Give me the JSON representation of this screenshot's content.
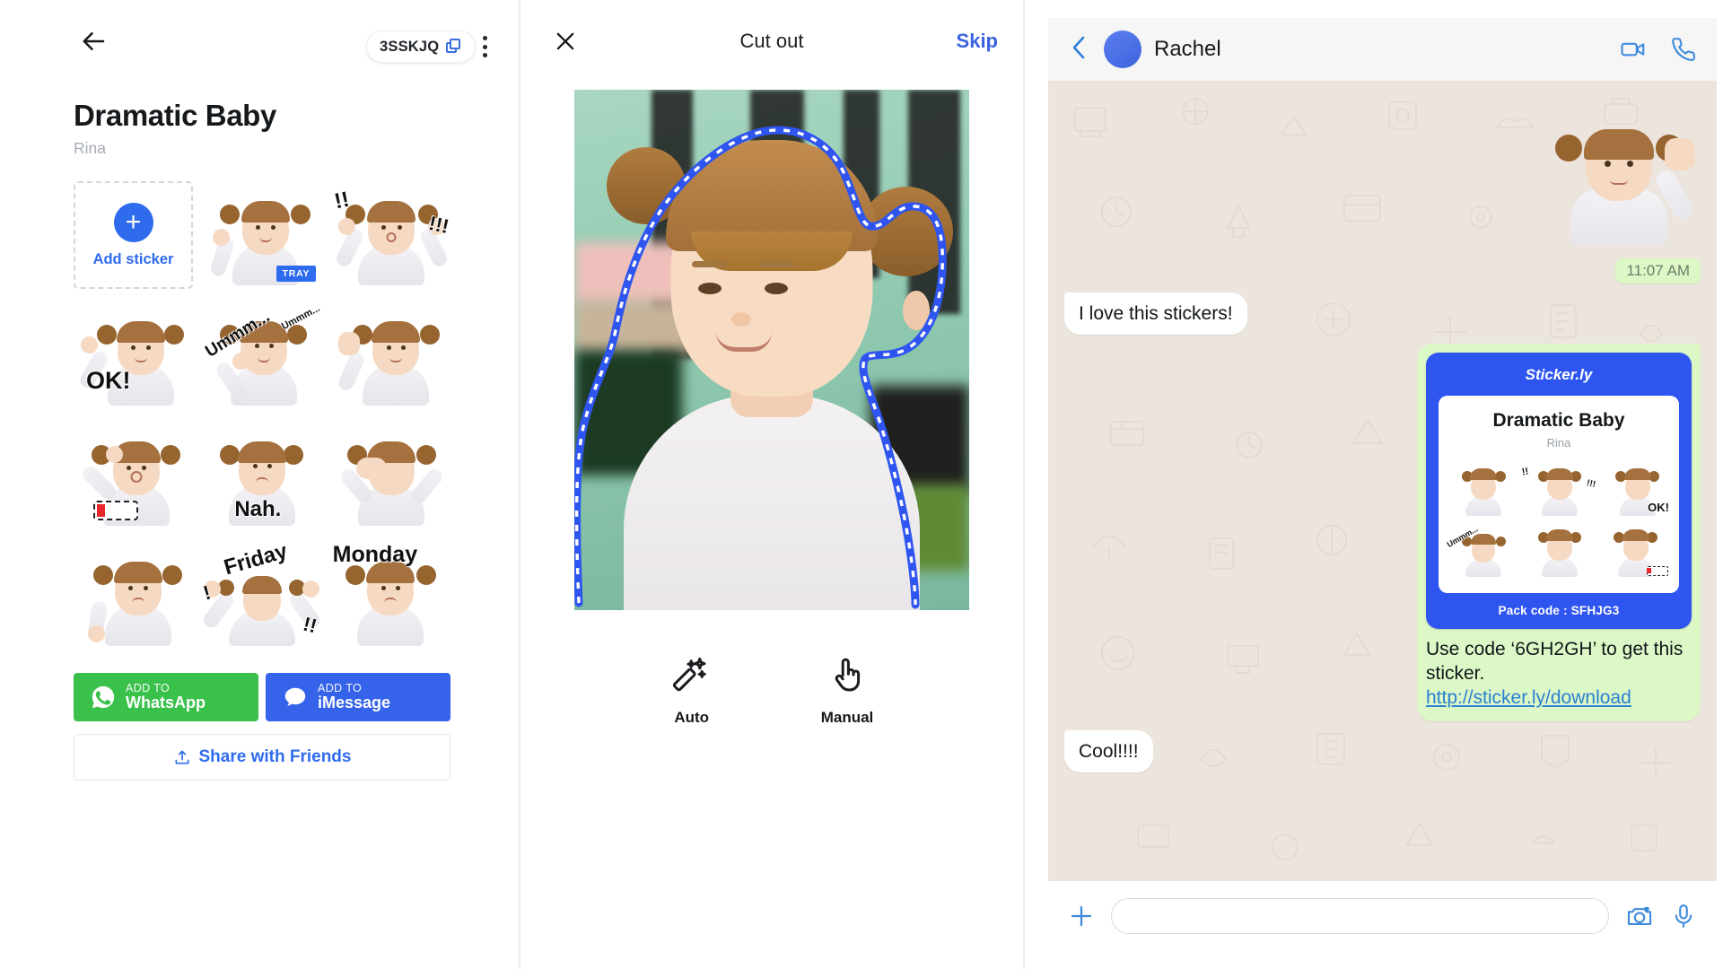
{
  "pack_detail": {
    "back_icon": "back-arrow-icon",
    "pack_code_pill": "3SSKJQ",
    "copy_icon": "copy-icon",
    "menu_icon": "kebab-menu-icon",
    "title": "Dramatic Baby",
    "author": "Rina",
    "add_sticker": {
      "plus_icon": "plus-icon",
      "label": "Add sticker"
    },
    "tray_badge": "TRAY",
    "stickers": [
      {
        "caption": "",
        "name": "sticker-thumbs-up",
        "tray": true
      },
      {
        "caption": "!!",
        "caption2": "!!!",
        "name": "sticker-shock"
      },
      {
        "caption": "OK!",
        "name": "sticker-ok"
      },
      {
        "caption": "Ummm...",
        "caption2": "Ummm...",
        "name": "sticker-ummm"
      },
      {
        "caption": "",
        "name": "sticker-stop-hand"
      },
      {
        "caption": "",
        "name": "sticker-low-battery"
      },
      {
        "caption": "Nah.",
        "name": "sticker-nah"
      },
      {
        "caption": "",
        "name": "sticker-facepalm"
      },
      {
        "caption": "",
        "name": "sticker-thumbs-down"
      },
      {
        "caption": "Friday",
        "caption2": "!",
        "caption3": "!!",
        "name": "sticker-friday"
      },
      {
        "caption": "Monday",
        "name": "sticker-monday"
      }
    ],
    "whatsapp_button": {
      "top": "ADD TO",
      "main": "WhatsApp",
      "icon": "whatsapp-icon",
      "color": "#3ac14b"
    },
    "imessage_button": {
      "top": "ADD TO",
      "main": "iMessage",
      "icon": "imessage-icon",
      "color": "#3563e9"
    },
    "share_button": {
      "label": "Share with Friends",
      "icon": "share-upload-icon",
      "color": "#2f6bed"
    }
  },
  "cut_out": {
    "close_icon": "close-x-icon",
    "title": "Cut out",
    "skip_label": "Skip",
    "selection_icon": "dashed-selection-path",
    "tools": [
      {
        "label": "Auto",
        "icon": "magic-wand-icon"
      },
      {
        "label": "Manual",
        "icon": "pointing-hand-icon"
      }
    ]
  },
  "chat": {
    "back_icon": "chevron-left-icon",
    "avatar": "contact-avatar",
    "contact_name": "Rachel",
    "video_icon": "video-camera-icon",
    "call_icon": "phone-call-icon",
    "timestamp": "11:07 AM",
    "incoming_message": "I love this stickers!",
    "reply_message": "Cool!!!!",
    "sticker_card": {
      "brand": "Sticker.ly",
      "pack_name": "Dramatic Baby",
      "pack_author": "Rina",
      "pack_code_label": "Pack code : SFHJG3"
    },
    "promo_text_line1": "Use code ‘6GH2GH’ to get this",
    "promo_text_line2": "sticker.",
    "promo_link": "http://sticker.ly/download",
    "composer": {
      "plus_icon": "plus-icon",
      "input_value": "",
      "input_placeholder": "",
      "camera_icon": "camera-icon",
      "mic_icon": "microphone-icon"
    }
  },
  "colors": {
    "accent_blue": "#2f6bed",
    "whatsapp_green": "#3ac14b",
    "imessage_blue": "#3563e9",
    "chat_bg": "#ece5dd",
    "outgoing_bubble": "#dcf8c6",
    "sticker_card_blue": "#2f55f0"
  }
}
